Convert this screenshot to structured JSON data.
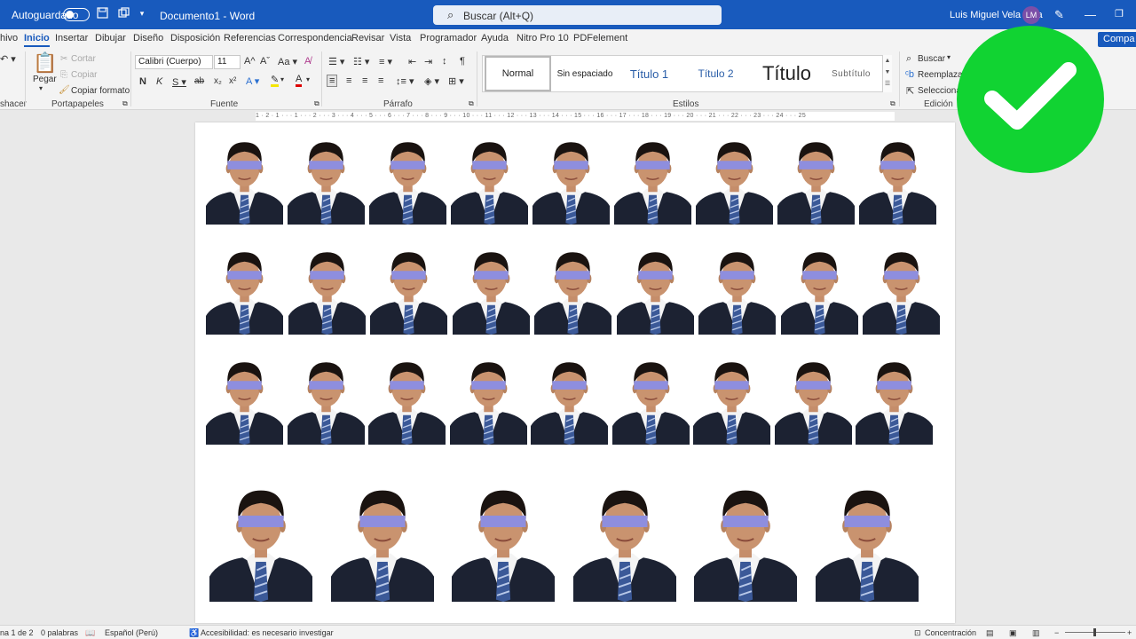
{
  "titlebar": {
    "autosave_label": "Autoguardado",
    "doc_title": "Documento1  -  Word",
    "search_placeholder": "Buscar (Alt+Q)",
    "user_name": "Luis Miguel Vela Vela",
    "user_initials": "LM"
  },
  "menu": {
    "items": [
      "hivo",
      "Inicio",
      "Insertar",
      "Dibujar",
      "Diseño",
      "Disposición",
      "Referencias",
      "Correspondencia",
      "Revisar",
      "Vista",
      "Programador",
      "Ayuda",
      "Nitro Pro 10",
      "PDFelement"
    ],
    "active": "Inicio",
    "share_label": "Compa"
  },
  "ribbon": {
    "undo_label": "shacer",
    "clipboard": {
      "paste": "Pegar",
      "cut": "Cortar",
      "copy": "Copiar",
      "format_painter": "Copiar formato",
      "label": "Portapapeles"
    },
    "font": {
      "family": "Calibri (Cuerpo)",
      "size": "11",
      "label": "Fuente"
    },
    "paragraph": {
      "label": "Párrafo"
    },
    "styles": {
      "items": [
        "Normal",
        "Sin espaciado",
        "Título 1",
        "Título 2",
        "Título",
        "Subtítulo"
      ],
      "label": "Estilos"
    },
    "editing": {
      "find": "Buscar",
      "replace": "Reemplazar",
      "select": "Seleccionar",
      "label": "Edición"
    }
  },
  "ruler": {
    "text": "1 · 2 · 1 · · · 1 · · · 2 · · · 3 · · · 4 · · · 5 · · · 6 · · · 7 · · · 8 · · · 9 · · · 10 · · · 11 · · · 12 · · · 13 · · · 14 · · · 15 · · · 16 · · · 17 · · · 18 · · · 19 · · · 20 · · · 21 · · · 22 · · · 23 · · · 24 · · · 25"
  },
  "document": {
    "rows": [
      {
        "count": 9
      },
      {
        "count": 9
      },
      {
        "count": 9
      },
      {
        "count": 6
      }
    ]
  },
  "statusbar": {
    "page": "na 1 de 2",
    "words": "0 palabras",
    "language": "Español (Perú)",
    "accessibility": "Accesibilidad: es necesario investigar",
    "focus": "Concentración"
  },
  "colors": {
    "titlebar": "#185abd",
    "badge": "#11d332",
    "eye_bar": "#8e8ede",
    "suit": "#1c2232"
  },
  "icons": [
    "save-icon",
    "undo-icon",
    "copy-icon",
    "search-icon",
    "pen-icon",
    "minimize-icon",
    "restore-icon",
    "checkmark-icon"
  ]
}
